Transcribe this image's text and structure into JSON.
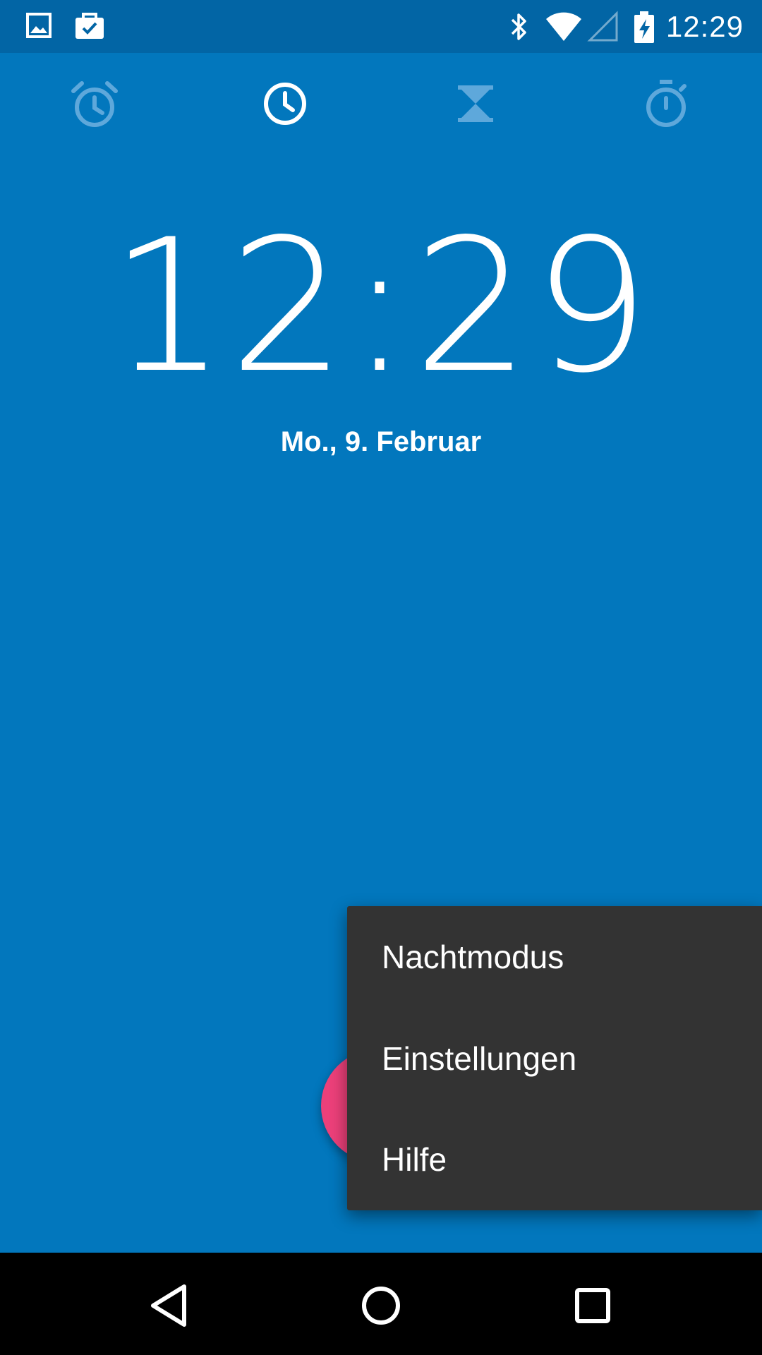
{
  "status_bar": {
    "time": "12:29",
    "icons": [
      "gallery-icon",
      "shopping-bag-icon",
      "bluetooth-icon",
      "wifi-icon",
      "signal-icon",
      "battery-charging-icon"
    ]
  },
  "tabs": [
    {
      "name": "alarm-icon",
      "selected": false
    },
    {
      "name": "clock-icon",
      "selected": true
    },
    {
      "name": "timer-icon",
      "selected": false
    },
    {
      "name": "stopwatch-icon",
      "selected": false
    }
  ],
  "clock": {
    "time": "12:29",
    "date": "Mo., 9. Februar"
  },
  "menu": {
    "items": [
      {
        "label": "Nachtmodus"
      },
      {
        "label": "Einstellungen"
      },
      {
        "label": "Hilfe"
      }
    ]
  },
  "nav_bar": {
    "icons": [
      "back-icon",
      "home-icon",
      "recents-icon"
    ]
  },
  "colors": {
    "primary": "#0277bd",
    "status_bar": "#0265a5",
    "fab": "#ec407a",
    "menu_bg": "#333333",
    "nav_bar": "#000000"
  }
}
